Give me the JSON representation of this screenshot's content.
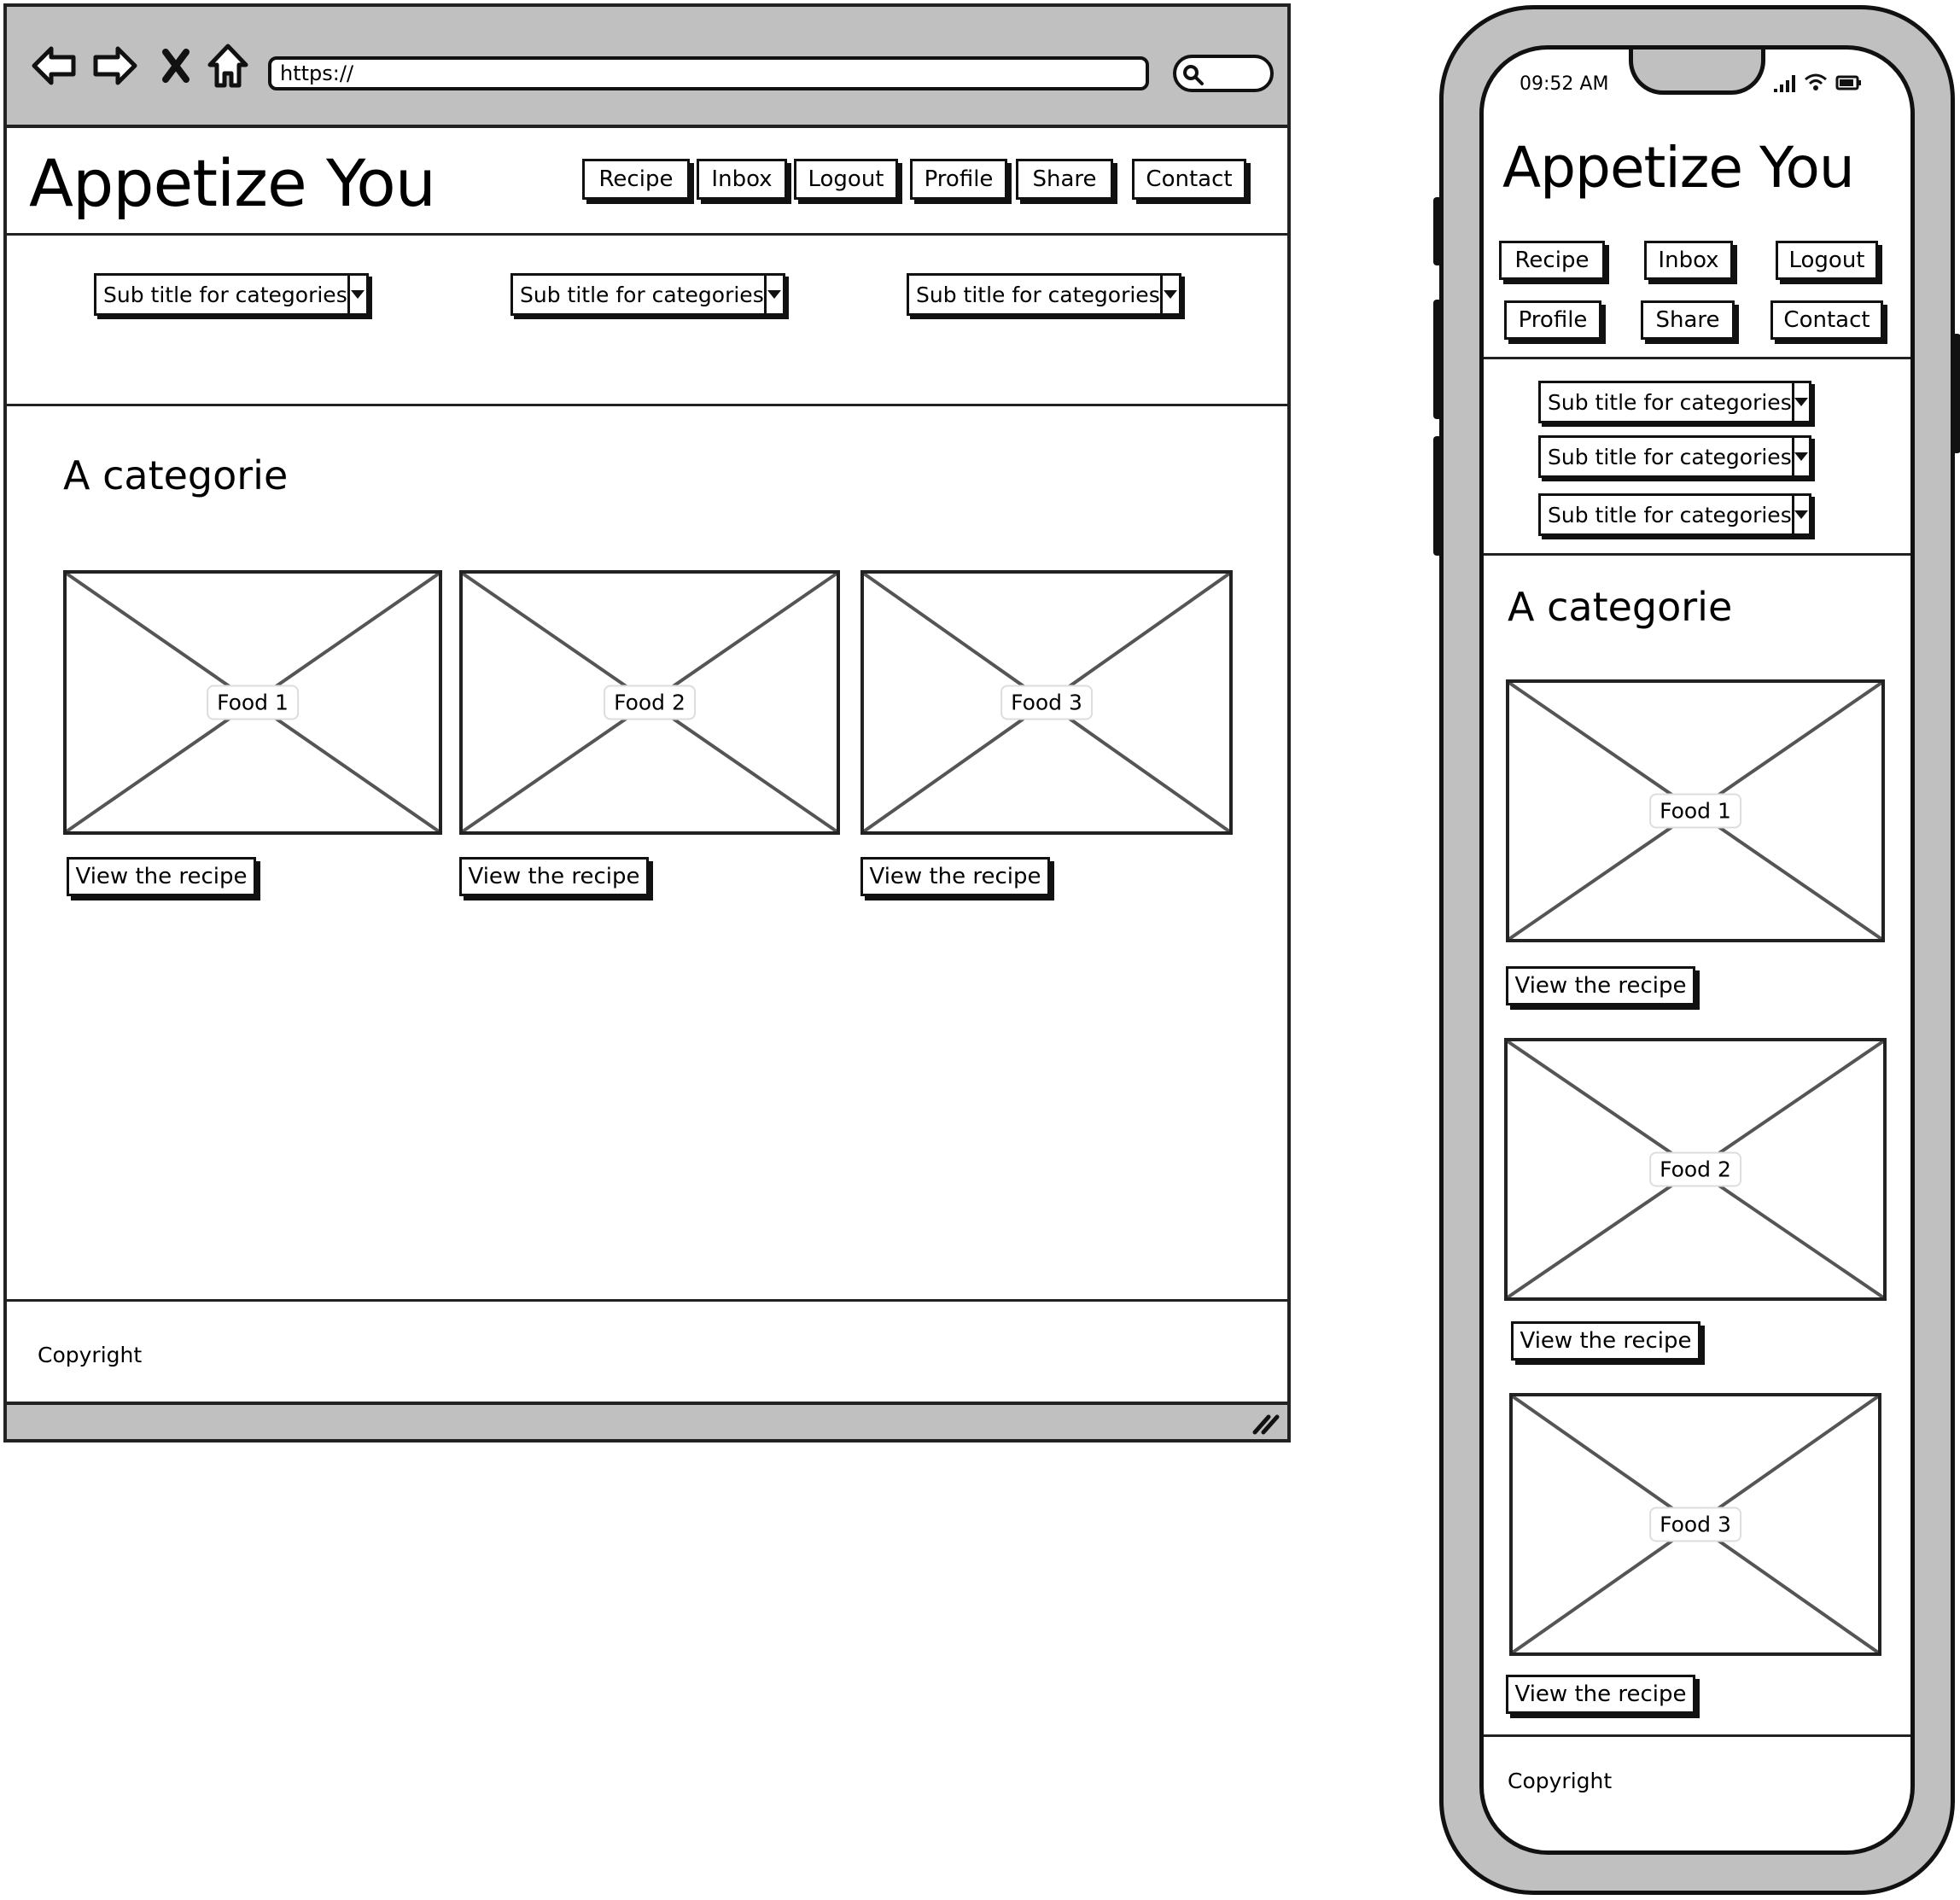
{
  "desktop": {
    "toolbar": {
      "back_icon": "arrow-left-icon",
      "forward_icon": "arrow-right-icon",
      "close_icon": "x-icon",
      "home_icon": "home-icon",
      "url": "https://",
      "search_icon": "search-icon"
    },
    "header": {
      "title": "Appetize You",
      "nav": [
        "Recipe",
        "Inbox",
        "Logout",
        "Profile",
        "Share",
        "Contact"
      ]
    },
    "subnav": {
      "selects": [
        "Sub title for categories",
        "Sub title for categories",
        "Sub title for categories"
      ]
    },
    "main": {
      "category_title": "A categorie",
      "cards": [
        {
          "label": "Food 1",
          "button": "View the recipe"
        },
        {
          "label": "Food 2",
          "button": "View the recipe"
        },
        {
          "label": "Food 3",
          "button": "View the recipe"
        }
      ]
    },
    "footer": {
      "text": "Copyright"
    },
    "resize_icon": "resize-grip-icon"
  },
  "mobile": {
    "status": {
      "time": "09:52 AM",
      "signal_icon": "signal-icon",
      "wifi_icon": "wifi-icon",
      "battery_icon": "battery-icon"
    },
    "header": {
      "title": "Appetize You",
      "nav": [
        "Recipe",
        "Inbox",
        "Logout",
        "Profile",
        "Share",
        "Contact"
      ]
    },
    "subnav": {
      "selects": [
        "Sub title for categories",
        "Sub title for categories",
        "Sub title for categories"
      ]
    },
    "main": {
      "category_title": "A categorie",
      "cards": [
        {
          "label": "Food 1",
          "button": "View the recipe"
        },
        {
          "label": "Food 2",
          "button": "View the recipe"
        },
        {
          "label": "Food 3",
          "button": "View the recipe"
        }
      ]
    },
    "footer": {
      "text": "Copyright"
    }
  },
  "colors": {
    "chrome": "#c0c0c0",
    "ink": "#111111",
    "cross": "#555555"
  }
}
